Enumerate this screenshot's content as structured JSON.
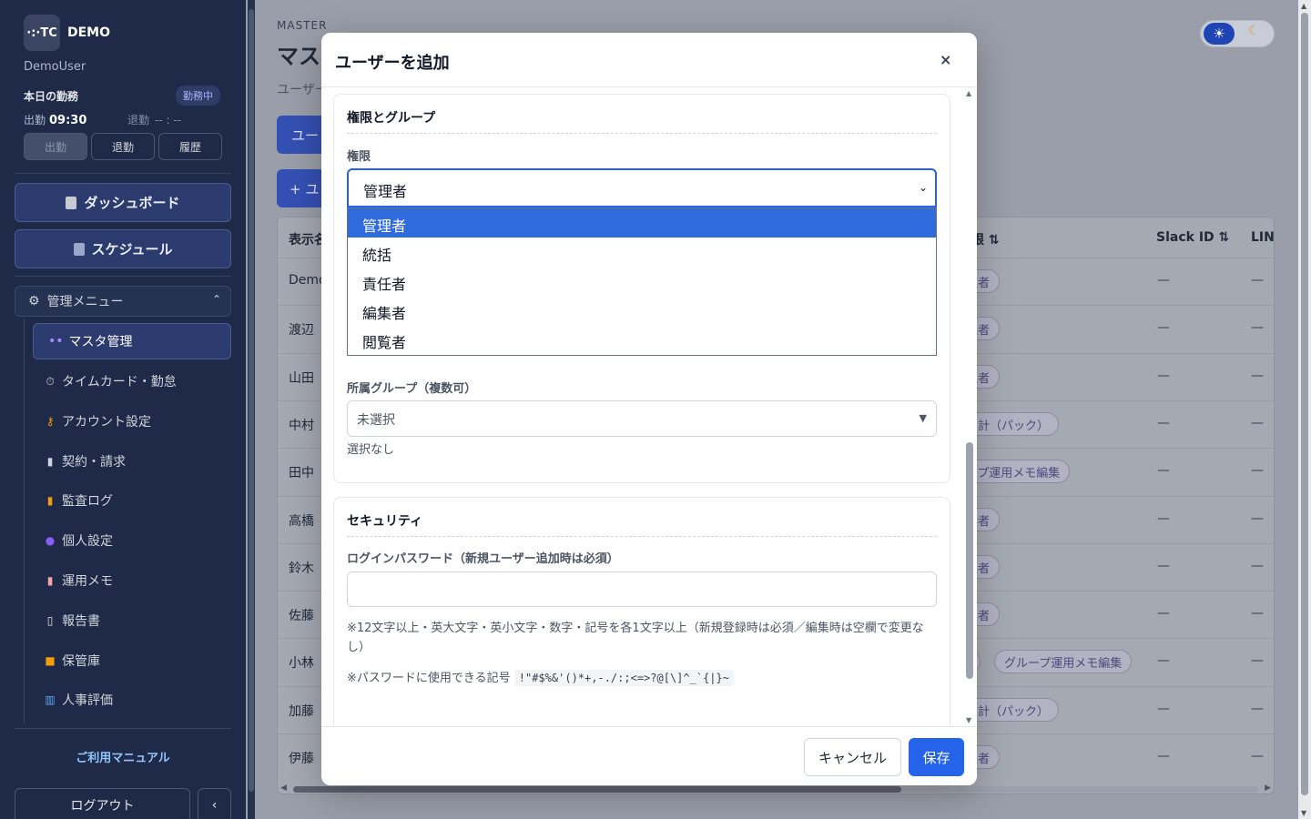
{
  "sidebar": {
    "logo": "·:·TC",
    "brand": "DEMO",
    "user": "DemoUser",
    "attendance": {
      "title": "本日の勤務",
      "status": "勤務中",
      "clock_in_label": "出勤",
      "clock_in_time": "09:30",
      "clock_out_label": "退勤",
      "clock_out_time": "-- : --",
      "buttons": [
        "出勤",
        "退勤",
        "履歴"
      ]
    },
    "dashboard": "ダッシュボード",
    "schedule": "スケジュール",
    "admin_menu": "管理メニュー",
    "admin_items": [
      {
        "label": "マスタ管理",
        "icon": "people-icon"
      },
      {
        "label": "タイムカード・勤怠",
        "icon": "timer-icon"
      },
      {
        "label": "アカウント設定",
        "icon": "key-icon"
      },
      {
        "label": "契約・請求",
        "icon": "document-icon"
      },
      {
        "label": "監査ログ",
        "icon": "ledger-icon"
      },
      {
        "label": "個人設定",
        "icon": "person-icon"
      },
      {
        "label": "運用メモ",
        "icon": "memo-icon"
      },
      {
        "label": "報告書",
        "icon": "report-icon"
      },
      {
        "label": "保管庫",
        "icon": "folder-icon"
      },
      {
        "label": "人事評価",
        "icon": "chart-icon"
      }
    ],
    "manual": "ご利用マニュアル",
    "logout": "ログアウト",
    "collapse": "‹"
  },
  "main": {
    "section_label": "MASTER",
    "title": "マス",
    "subtitle": "ユーザー",
    "tab": "ユー",
    "add_button": "+ ユ",
    "table": {
      "headers": [
        "表示名",
        "限 ⇅",
        "Slack ID ⇅",
        "LINE"
      ],
      "rows": [
        {
          "name": "Demo",
          "pills": [
            "理者"
          ],
          "slack": "—",
          "line": "—"
        },
        {
          "name": "渡辺",
          "pills": [
            "理者"
          ],
          "slack": "—",
          "line": "—"
        },
        {
          "name": "山田",
          "pills": [
            "理者"
          ],
          "slack": "—",
          "line": "—"
        },
        {
          "name": "中村",
          "pills": [
            "集計（パック）"
          ],
          "slack": "—",
          "line": "—"
        },
        {
          "name": "田中",
          "pills": [
            "ープ運用メモ編集"
          ],
          "slack": "—",
          "line": "—"
        },
        {
          "name": "高橋",
          "pills": [
            "集者"
          ],
          "slack": "—",
          "line": "—"
        },
        {
          "name": "鈴木",
          "pills": [
            "集者"
          ],
          "slack": "—",
          "line": "—"
        },
        {
          "name": "佐藤",
          "pills": [
            "集者"
          ],
          "slack": "—",
          "line": "—"
        },
        {
          "name": "小林",
          "pills": [
            ")",
            "グループ運用メモ編集"
          ],
          "slack": "—",
          "line": "—"
        },
        {
          "name": "加藤",
          "pills": [
            "集計（パック）"
          ],
          "slack": "—",
          "line": "—"
        },
        {
          "name": "伊藤",
          "pills": [
            "集者"
          ],
          "slack": "—",
          "line": "—"
        }
      ]
    }
  },
  "theme": {
    "light": "☀",
    "dark": "☾"
  },
  "modal": {
    "title": "ユーザーを追加",
    "close": "×",
    "permissions_section": {
      "title": "権限とグループ",
      "role_label": "権限",
      "role_value": "管理者",
      "role_options": [
        "管理者",
        "統括",
        "責任者",
        "編集者",
        "閲覧者"
      ],
      "selected_index": 0,
      "group_label": "所属グループ（複数可）",
      "group_placeholder": "未選択",
      "group_selected": "選択なし"
    },
    "security_section": {
      "title": "セキュリティ",
      "password_label": "ログインパスワード（新規ユーザー追加時は必須）",
      "password_value": "",
      "rule_hint": "※12文字以上・英大文字・英小文字・数字・記号を各1文字以上（新規登録時は必須／編集時は空欄で変更なし）",
      "symbols_label": "※パスワードに使用できる記号",
      "symbols": "!\"#$%&'()*+,-./:;<=>?@[\\]^_`{|}~"
    },
    "cancel": "キャンセル",
    "save": "保存"
  }
}
